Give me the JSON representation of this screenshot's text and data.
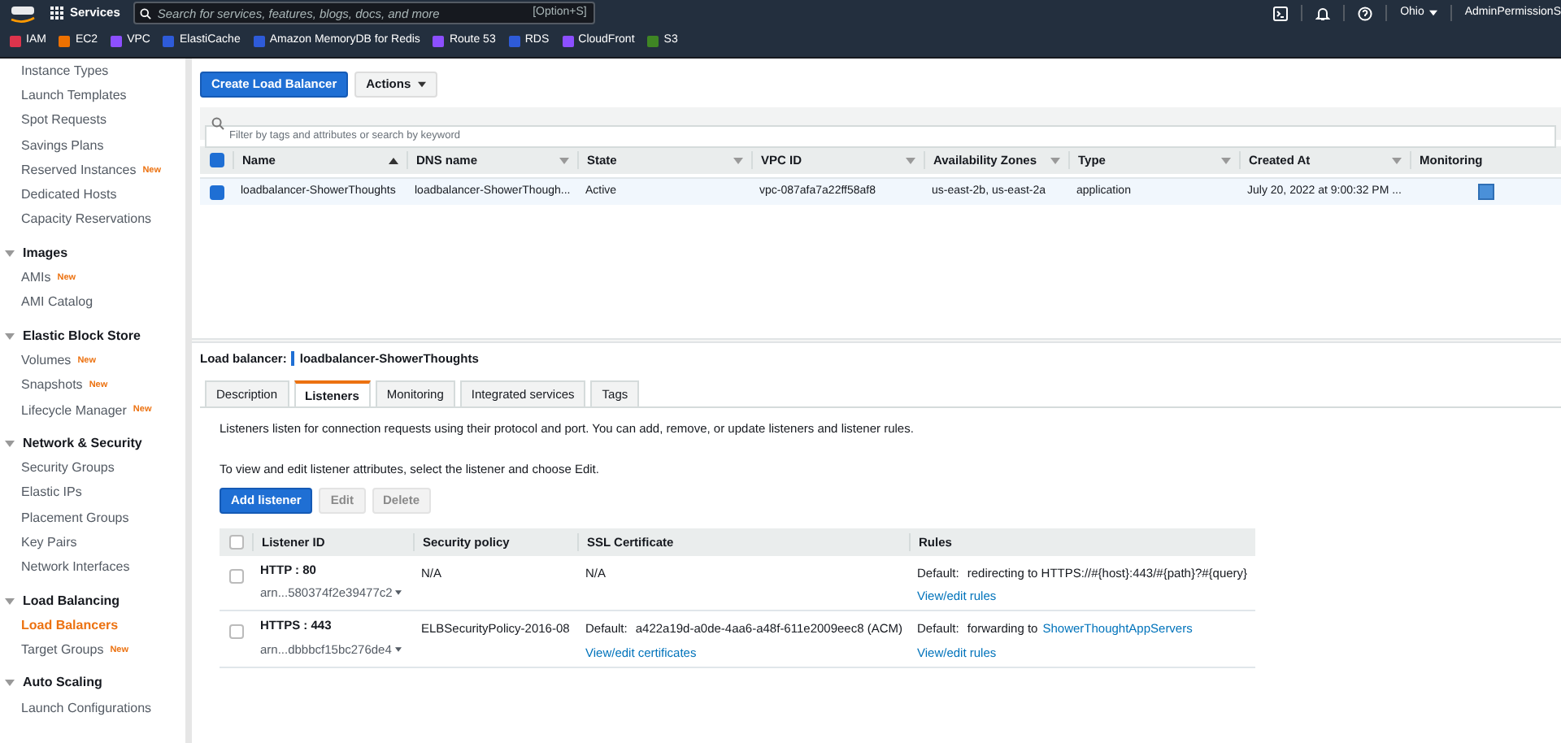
{
  "top_nav": {
    "services": "Services",
    "search": {
      "placeholder": "Search for services, features, blogs, docs, and more",
      "shortcut": "[Option+S]"
    },
    "region": "Ohio",
    "account": "AdminPermissionS"
  },
  "favorites": [
    {
      "label": "IAM",
      "color": "#dd344c"
    },
    {
      "label": "EC2",
      "color": "#ed7100"
    },
    {
      "label": "VPC",
      "color": "#8c4fff"
    },
    {
      "label": "ElastiCache",
      "color": "#2e5bd9"
    },
    {
      "label": "Amazon MemoryDB for Redis",
      "color": "#2e5bd9"
    },
    {
      "label": "Route 53",
      "color": "#8c4fff"
    },
    {
      "label": "RDS",
      "color": "#2e5bd9"
    },
    {
      "label": "CloudFront",
      "color": "#8c4fff"
    },
    {
      "label": "S3",
      "color": "#3f8624"
    }
  ],
  "sidebar": {
    "sections": [
      {
        "items": [
          {
            "label": "Instance Types",
            "selected": false
          },
          {
            "label": "Launch Templates",
            "selected": false
          },
          {
            "label": "Spot Requests",
            "selected": false
          },
          {
            "label": "Savings Plans",
            "selected": false
          },
          {
            "label": "Reserved Instances",
            "badge": "New",
            "selected": false
          },
          {
            "label": "Dedicated Hosts",
            "selected": false
          },
          {
            "label": "Capacity Reservations",
            "selected": false
          }
        ]
      },
      {
        "title": "Images",
        "expanded": true,
        "items": [
          {
            "label": "AMIs",
            "badge": "New",
            "selected": false
          },
          {
            "label": "AMI Catalog",
            "selected": false
          }
        ]
      },
      {
        "title": "Elastic Block Store",
        "expanded": true,
        "items": [
          {
            "label": "Volumes",
            "badge": "New",
            "selected": false
          },
          {
            "label": "Snapshots",
            "badge": "New",
            "selected": false
          },
          {
            "label": "Lifecycle Manager",
            "badge": "New",
            "selected": false
          }
        ]
      },
      {
        "title": "Network & Security",
        "expanded": true,
        "items": [
          {
            "label": "Security Groups",
            "selected": false
          },
          {
            "label": "Elastic IPs",
            "selected": false
          },
          {
            "label": "Placement Groups",
            "selected": false
          },
          {
            "label": "Key Pairs",
            "selected": false
          },
          {
            "label": "Network Interfaces",
            "selected": false
          }
        ]
      },
      {
        "title": "Load Balancing",
        "expanded": true,
        "items": [
          {
            "label": "Load Balancers",
            "selected": true
          },
          {
            "label": "Target Groups",
            "badge": "New",
            "selected": false
          }
        ]
      },
      {
        "title": "Auto Scaling",
        "expanded": true,
        "items": [
          {
            "label": "Launch Configurations",
            "selected": false
          }
        ]
      }
    ]
  },
  "toolbar": {
    "create": "Create Load Balancer",
    "actions": "Actions"
  },
  "filter": {
    "placeholder": "Filter by tags and attributes or search by keyword"
  },
  "table": {
    "all_selected": true,
    "columns": [
      "Name",
      "DNS name",
      "State",
      "VPC ID",
      "Availability Zones",
      "Type",
      "Created At",
      "Monitoring"
    ],
    "rows": [
      {
        "selected": true,
        "cells": [
          "loadbalancer-ShowerThoughts",
          "loadbalancer-ShowerThough...",
          "Active",
          "vpc-087afa7a22ff58af8",
          "us-east-2b, us-east-2a",
          "application",
          "July 20, 2022 at 9:00:32 PM ..."
        ]
      }
    ]
  },
  "detail": {
    "label": "Load balancer:",
    "name": "loadbalancer-ShowerThoughts",
    "tabs": [
      {
        "label": "Description",
        "selected": false
      },
      {
        "label": "Listeners",
        "selected": true
      },
      {
        "label": "Monitoring",
        "selected": false
      },
      {
        "label": "Integrated services",
        "selected": false
      },
      {
        "label": "Tags",
        "selected": false
      }
    ],
    "intro": "Listeners listen for connection requests using their protocol and port. You can add, remove, or update listeners and listener rules.",
    "hint": "To view and edit listener attributes, select the listener and choose Edit.",
    "buttons": [
      {
        "label": "Add listener",
        "disabled": false
      },
      {
        "label": "Edit",
        "disabled": true
      },
      {
        "label": "Delete",
        "disabled": true
      }
    ],
    "listeners": {
      "all_selected": false,
      "columns": [
        "Listener ID",
        "Security policy",
        "SSL Certificate",
        "Rules"
      ],
      "rows": [
        {
          "selected": false,
          "id": "HTTP : 80",
          "arn": "arn...580374f2e39477c2",
          "policy": "N/A",
          "ssl": {
            "kind": "plain",
            "text": "N/A"
          },
          "rules": {
            "label": "Default:",
            "text": "redirecting to HTTPS://#{host}:443/#{path}?#{query}",
            "link": "View/edit rules"
          }
        },
        {
          "selected": false,
          "id": "HTTPS : 443",
          "arn": "arn...dbbbcf15bc276de4",
          "policy": "ELBSecurityPolicy-2016-08",
          "ssl": {
            "kind": "cert",
            "label": "Default:",
            "text": "a422a19d-a0de-4aa6-a48f-611e2009eec8 (ACM)",
            "link": "View/edit certificates"
          },
          "rules": {
            "label": "Default:",
            "text": "forwarding to",
            "target": "ShowerThoughtAppServers",
            "link": "View/edit rules"
          }
        }
      ]
    }
  }
}
